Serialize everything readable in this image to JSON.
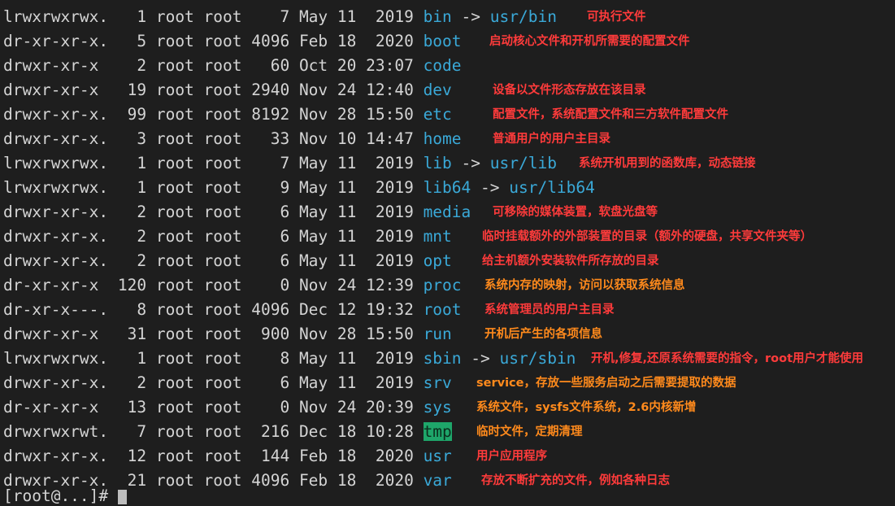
{
  "terminal": {
    "rows": [
      {
        "meta": "lrwxrwxrwx.   1 root root    7 May 11  2019 ",
        "name": "bin",
        "link": " -> ",
        "target": "usr/bin",
        "note": "可执行文件",
        "note_color": "#ff3b3b"
      },
      {
        "meta": "dr-xr-xr-x.   5 root root 4096 Feb 18  2020 ",
        "name": "boot",
        "link": "",
        "target": "",
        "note": "启动核心文件和开机所需要的配置文件",
        "note_color": "#ff3b3b"
      },
      {
        "meta": "drwxr-xr-x    2 root root   60 Oct 20 23:07 ",
        "name": "code",
        "link": "",
        "target": "",
        "note": "",
        "note_color": "#ff3b3b"
      },
      {
        "meta": "drwxr-xr-x   19 root root 2940 Nov 24 12:40 ",
        "name": "dev",
        "link": "",
        "target": "",
        "note": "设备以文件形态存放在该目录",
        "note_color": "#ff3b3b"
      },
      {
        "meta": "drwxr-xr-x.  99 root root 8192 Nov 28 15:50 ",
        "name": "etc",
        "link": "",
        "target": "",
        "note": "配置文件，系统配置文件和三方软件配置文件",
        "note_color": "#ff3b3b"
      },
      {
        "meta": "drwxr-xr-x.   3 root root   33 Nov 10 14:47 ",
        "name": "home",
        "link": "",
        "target": "",
        "note": "普通用户的用户主目录",
        "note_color": "#ff3b3b"
      },
      {
        "meta": "lrwxrwxrwx.   1 root root    7 May 11  2019 ",
        "name": "lib",
        "link": " -> ",
        "target": "usr/lib",
        "note": "系统开机用到的函数库，动态链接",
        "note_color": "#ff3b3b"
      },
      {
        "meta": "lrwxrwxrwx.   1 root root    9 May 11  2019 ",
        "name": "lib64",
        "link": " -> ",
        "target": "usr/lib64",
        "note": "",
        "note_color": "#ff3b3b"
      },
      {
        "meta": "drwxr-xr-x.   2 root root    6 May 11  2019 ",
        "name": "media",
        "link": "",
        "target": "",
        "note": "可移除的媒体装置，软盘光盘等",
        "note_color": "#ff3b3b"
      },
      {
        "meta": "drwxr-xr-x.   2 root root    6 May 11  2019 ",
        "name": "mnt",
        "link": "",
        "target": "",
        "note": "临时挂载额外的外部装置的目录（额外的硬盘，共享文件夹等）",
        "note_color": "#ff3b3b"
      },
      {
        "meta": "drwxr-xr-x.   2 root root    6 May 11  2019 ",
        "name": "opt",
        "link": "",
        "target": "",
        "note": "给主机额外安装软件所存放的目录",
        "note_color": "#ff3b3b"
      },
      {
        "meta": "dr-xr-xr-x  120 root root    0 Nov 24 12:39 ",
        "name": "proc",
        "link": "",
        "target": "",
        "note": "系统内存的映射，访问以获取系统信息",
        "note_color": "#ff8a1c"
      },
      {
        "meta": "dr-xr-x---.   8 root root 4096 Dec 12 19:32 ",
        "name": "root",
        "link": "",
        "target": "",
        "note": "系统管理员的用户主目录",
        "note_color": "#ff3b3b"
      },
      {
        "meta": "drwxr-xr-x   31 root root  900 Nov 28 15:50 ",
        "name": "run",
        "link": "",
        "target": "",
        "note": "开机后产生的各项信息",
        "note_color": "#ff8a1c"
      },
      {
        "meta": "lrwxrwxrwx.   1 root root    8 May 11  2019 ",
        "name": "sbin",
        "link": " -> ",
        "target": "usr/sbin",
        "note": "开机,修复,还原系统需要的指令，root用户才能使用",
        "note_color": "#ff3b3b"
      },
      {
        "meta": "drwxr-xr-x.   2 root root    6 May 11  2019 ",
        "name": "srv",
        "link": "",
        "target": "",
        "note": "service，存放一些服务启动之后需要提取的数据",
        "note_color": "#ff8a1c"
      },
      {
        "meta": "dr-xr-xr-x   13 root root    0 Nov 24 20:39 ",
        "name": "sys",
        "link": "",
        "target": "",
        "note": "系统文件，sysfs文件系统，2.6内核新增",
        "note_color": "#ff8a1c"
      },
      {
        "meta": "drwxrwxrwt.   7 root root  216 Dec 18 10:28 ",
        "name": "tmp",
        "link": "",
        "target": "",
        "note": "临时文件，定期清理",
        "note_color": "#ff8a1c"
      },
      {
        "meta": "drwxr-xr-x.  12 root root  144 Feb 18  2020 ",
        "name": "usr",
        "link": "",
        "target": "",
        "note": "用户应用程序",
        "note_color": "#ff3b3b"
      },
      {
        "meta": "drwxr-xr-x.  21 root root 4096 Feb 18  2020 ",
        "name": "var",
        "link": "",
        "target": "",
        "note": "存放不断扩充的文件，例如各种日志",
        "note_color": "#ff3b3b"
      }
    ],
    "prompt": "[root@...]# "
  }
}
